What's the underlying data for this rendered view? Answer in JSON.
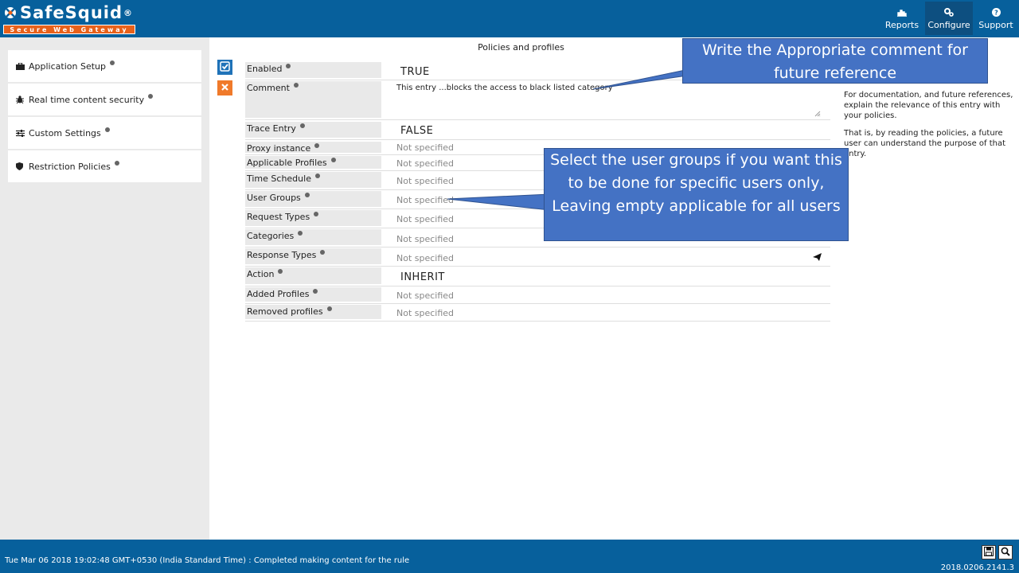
{
  "app": {
    "logo_title": "SafeSquid",
    "logo_reg": "®",
    "logo_subtitle": "Secure Web Gateway"
  },
  "topnav": {
    "reports": "Reports",
    "configure": "Configure",
    "support": "Support"
  },
  "sidebar": {
    "items": [
      {
        "label": "Application Setup"
      },
      {
        "label": "Real time content security"
      },
      {
        "label": "Custom Settings"
      },
      {
        "label": "Restriction Policies"
      }
    ]
  },
  "main": {
    "title": "Policies and profiles",
    "fields": [
      {
        "label": "Enabled",
        "value": "TRUE"
      },
      {
        "label": "Comment",
        "value": "This entry ...blocks the access to black listed category"
      },
      {
        "label": "Trace Entry",
        "value": "FALSE"
      },
      {
        "label": "Proxy instance",
        "value": "Not specified"
      },
      {
        "label": "Applicable Profiles",
        "value": "Not specified"
      },
      {
        "label": "Time Schedule",
        "value": "Not specified"
      },
      {
        "label": "User Groups",
        "value": "Not specified"
      },
      {
        "label": "Request Types",
        "value": "Not specified"
      },
      {
        "label": "Categories",
        "value": "Not specified"
      },
      {
        "label": "Response Types",
        "value": "Not specified"
      },
      {
        "label": "Action",
        "value": "INHERIT"
      },
      {
        "label": "Added Profiles",
        "value": "Not specified"
      },
      {
        "label": "Removed profiles",
        "value": "Not specified"
      }
    ]
  },
  "help": {
    "para1": "For documentation, and future references, explain the relevance of this entry with your policies.",
    "para2": "That is, by reading the policies, a future user can understand the purpose of that entry."
  },
  "callouts": {
    "comment": "Write the Appropriate comment for future reference",
    "user_groups": "Select the user groups if you want this to be done for specific users only, Leaving empty applicable for all users"
  },
  "footer": {
    "status": "Tue Mar 06 2018 19:02:48 GMT+0530 (India Standard Time) : Completed making content for the rule",
    "version": "2018.0206.2141.3"
  },
  "colors": {
    "header": "#07609c",
    "accent_orange": "#f07a2a",
    "callout": "#4472c4"
  }
}
